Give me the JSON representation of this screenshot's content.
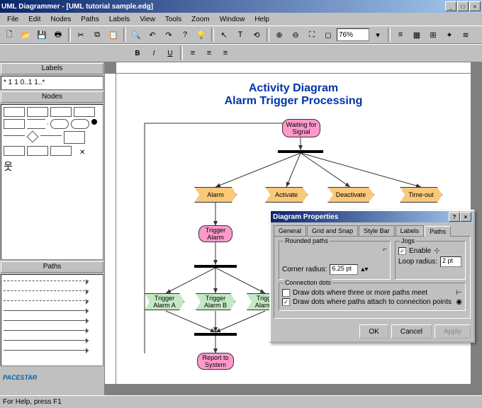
{
  "title": "UML Diagrammer - [UML tutorial sample.edg]",
  "menu": [
    "File",
    "Edit",
    "Nodes",
    "Paths",
    "Labels",
    "View",
    "Tools",
    "Zoom",
    "Window",
    "Help"
  ],
  "zoom": "76%",
  "panels": {
    "labels": "Labels",
    "nodes": "Nodes",
    "paths": "Paths",
    "label_items": [
      "* 1",
      "1 0..1",
      "1..*"
    ]
  },
  "diagram": {
    "title1": "Activity Diagram",
    "title2": "Alarm Trigger Processing",
    "nodes": {
      "waiting": "Waiting for Signal",
      "alarm": "Alarm",
      "activate": "Activate",
      "deactivate": "Deactivate",
      "timeout": "Time-out",
      "trigger_alarm": "Trigger Alarm",
      "trigger_a": "Trigger Alarm A",
      "trigger_b": "Trigger Alarm B",
      "trigger_c": "Trigger Alarm C",
      "report": "Report to System"
    }
  },
  "dialog": {
    "title": "Diagram Properties",
    "tabs": [
      "General",
      "Grid and Snap",
      "Style Bar",
      "Labels",
      "Paths"
    ],
    "active_tab": 4,
    "rounded": {
      "legend": "Rounded paths",
      "corner_label": "Corner radius:",
      "corner_val": "6.25 pt"
    },
    "jogs": {
      "legend": "Jogs",
      "enable": "Enable",
      "loop_label": "Loop radius:",
      "loop_val": "2 pt"
    },
    "dots": {
      "legend": "Connection dots",
      "cb1": "Draw dots where three or more paths meet",
      "cb2": "Draw dots where paths attach to connection points"
    },
    "ok": "OK",
    "cancel": "Cancel",
    "apply": "Apply"
  },
  "status": "For Help, press F1",
  "brand": "PACESTAR"
}
